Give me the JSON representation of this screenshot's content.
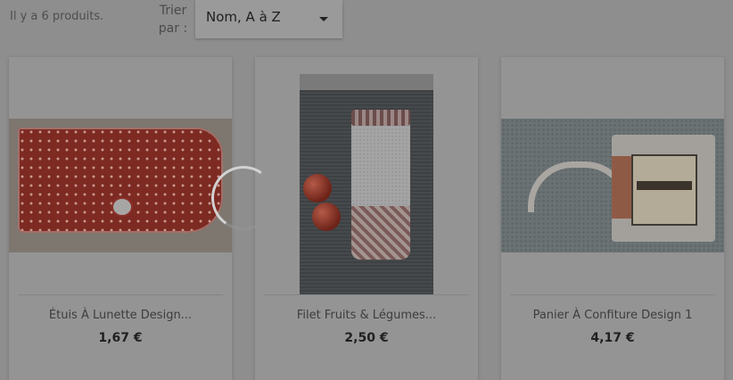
{
  "listing": {
    "product_count_text": "Il y a 6 produits.",
    "sort_label": "Trier par :",
    "sort_selected": "Nom, A à Z"
  },
  "products": [
    {
      "title": "Étuis À Lunette Design...",
      "price": "1,67 €"
    },
    {
      "title": "Filet Fruits & Légumes...",
      "price": "2,50 €"
    },
    {
      "title": "Panier À Confiture Design 1",
      "price": "4,17 €"
    }
  ],
  "icons": {
    "sort_caret": "caret-down-icon",
    "loading": "loading-spinner-icon"
  }
}
